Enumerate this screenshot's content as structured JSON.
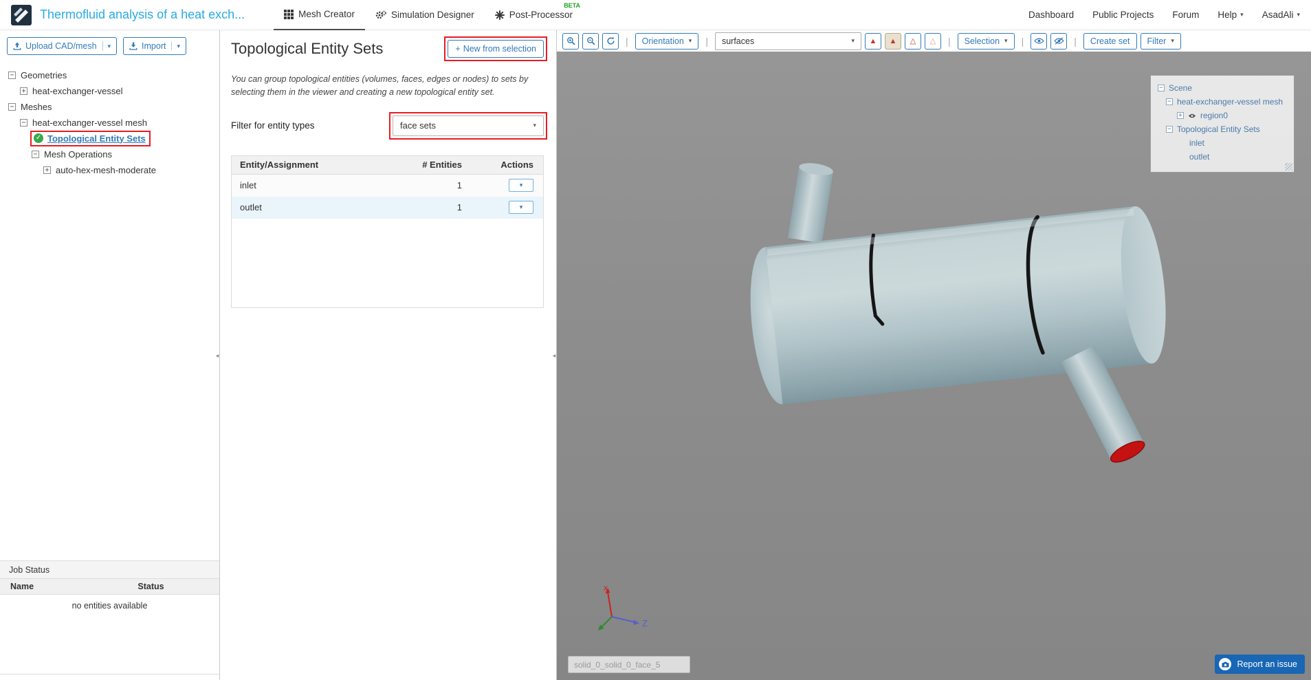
{
  "colors": {
    "accent_blue": "#337ab7",
    "title_blue": "#29abe2",
    "success_green": "#39a74a",
    "annotation_red": "#ea1b22",
    "viewer_bg": "#8d8d8d",
    "vessel_gray_blue": "#b9cbd0",
    "outlet_face_red": "#c41212",
    "report_blue": "#1866b4"
  },
  "header": {
    "project_title": "Thermofluid analysis of a heat exch...",
    "tabs": [
      {
        "label": "Mesh Creator"
      },
      {
        "label": "Simulation Designer"
      },
      {
        "label": "Post-Processor",
        "badge": "BETA"
      }
    ],
    "nav": [
      {
        "label": "Dashboard"
      },
      {
        "label": "Public Projects"
      },
      {
        "label": "Forum"
      },
      {
        "label": "Help"
      },
      {
        "label": "AsadAli"
      }
    ]
  },
  "sidebar": {
    "upload_button": "Upload CAD/mesh",
    "import_button": "Import",
    "tree": [
      {
        "label": "Geometries"
      },
      {
        "label": "heat-exchanger-vessel"
      },
      {
        "label": "Meshes"
      },
      {
        "label": "heat-exchanger-vessel mesh"
      },
      {
        "label": "Topological Entity Sets"
      },
      {
        "label": "Mesh Operations"
      },
      {
        "label": "auto-hex-mesh-moderate"
      }
    ],
    "job_status": {
      "title": "Job Status",
      "columns": [
        "Name",
        "Status"
      ],
      "empty_text": "no entities available"
    }
  },
  "panel": {
    "title": "Topological Entity Sets",
    "new_button": "New from selection",
    "description": "You can group topological entities (volumes, faces, edges or nodes) to sets by selecting them in the viewer and creating a new topological entity set.",
    "filter_label": "Filter for entity types",
    "filter_value": "face sets",
    "table": {
      "columns": [
        "Entity/Assignment",
        "# Entities",
        "Actions"
      ],
      "rows": [
        {
          "name": "inlet",
          "count": "1"
        },
        {
          "name": "outlet",
          "count": "1"
        }
      ]
    }
  },
  "viewer": {
    "toolbar": {
      "orientation": "Orientation",
      "surfaces": "surfaces",
      "selection": "Selection",
      "create_set": "Create set",
      "filter": "Filter"
    },
    "scene_tree": [
      {
        "label": "Scene"
      },
      {
        "label": "heat-exchanger-vessel mesh"
      },
      {
        "label": "region0"
      },
      {
        "label": "Topological Entity Sets"
      },
      {
        "label": "inlet"
      },
      {
        "label": "outlet"
      }
    ],
    "axis_labels": {
      "x": "x",
      "z": "Z"
    },
    "face_input_value": "solid_0_solid_0_face_5",
    "report_button": "Report an issue"
  },
  "icons": {
    "caret": "▾",
    "plus": "+",
    "minus": "−",
    "check": "✓",
    "collapse_left": "◂",
    "separator": "|",
    "triangle_filled": "▲",
    "triangle_outline": "△"
  }
}
